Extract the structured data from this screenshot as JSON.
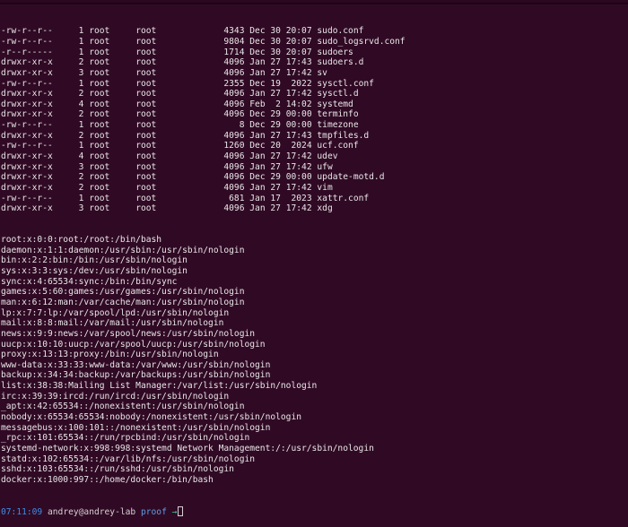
{
  "listing": [
    {
      "perms": "-rw-r--r--",
      "links": "1",
      "owner": "root",
      "group": "root",
      "size": "4343",
      "month": "Dec",
      "day": "30",
      "time": "20:07",
      "name": "sudo.conf"
    },
    {
      "perms": "-rw-r--r--",
      "links": "1",
      "owner": "root",
      "group": "root",
      "size": "9804",
      "month": "Dec",
      "day": "30",
      "time": "20:07",
      "name": "sudo_logsrvd.conf"
    },
    {
      "perms": "-r--r-----",
      "links": "1",
      "owner": "root",
      "group": "root",
      "size": "1714",
      "month": "Dec",
      "day": "30",
      "time": "20:07",
      "name": "sudoers"
    },
    {
      "perms": "drwxr-xr-x",
      "links": "2",
      "owner": "root",
      "group": "root",
      "size": "4096",
      "month": "Jan",
      "day": "27",
      "time": "17:43",
      "name": "sudoers.d"
    },
    {
      "perms": "drwxr-xr-x",
      "links": "3",
      "owner": "root",
      "group": "root",
      "size": "4096",
      "month": "Jan",
      "day": "27",
      "time": "17:42",
      "name": "sv"
    },
    {
      "perms": "-rw-r--r--",
      "links": "1",
      "owner": "root",
      "group": "root",
      "size": "2355",
      "month": "Dec",
      "day": "19",
      "time": " 2022",
      "name": "sysctl.conf"
    },
    {
      "perms": "drwxr-xr-x",
      "links": "2",
      "owner": "root",
      "group": "root",
      "size": "4096",
      "month": "Jan",
      "day": "27",
      "time": "17:42",
      "name": "sysctl.d"
    },
    {
      "perms": "drwxr-xr-x",
      "links": "4",
      "owner": "root",
      "group": "root",
      "size": "4096",
      "month": "Feb",
      "day": " 2",
      "time": "14:02",
      "name": "systemd"
    },
    {
      "perms": "drwxr-xr-x",
      "links": "2",
      "owner": "root",
      "group": "root",
      "size": "4096",
      "month": "Dec",
      "day": "29",
      "time": "00:00",
      "name": "terminfo"
    },
    {
      "perms": "-rw-r--r--",
      "links": "1",
      "owner": "root",
      "group": "root",
      "size": "8",
      "month": "Dec",
      "day": "29",
      "time": "00:00",
      "name": "timezone"
    },
    {
      "perms": "drwxr-xr-x",
      "links": "2",
      "owner": "root",
      "group": "root",
      "size": "4096",
      "month": "Jan",
      "day": "27",
      "time": "17:43",
      "name": "tmpfiles.d"
    },
    {
      "perms": "-rw-r--r--",
      "links": "1",
      "owner": "root",
      "group": "root",
      "size": "1260",
      "month": "Dec",
      "day": "20",
      "time": " 2024",
      "name": "ucf.conf"
    },
    {
      "perms": "drwxr-xr-x",
      "links": "4",
      "owner": "root",
      "group": "root",
      "size": "4096",
      "month": "Jan",
      "day": "27",
      "time": "17:42",
      "name": "udev"
    },
    {
      "perms": "drwxr-xr-x",
      "links": "3",
      "owner": "root",
      "group": "root",
      "size": "4096",
      "month": "Jan",
      "day": "27",
      "time": "17:42",
      "name": "ufw"
    },
    {
      "perms": "drwxr-xr-x",
      "links": "2",
      "owner": "root",
      "group": "root",
      "size": "4096",
      "month": "Dec",
      "day": "29",
      "time": "00:00",
      "name": "update-motd.d"
    },
    {
      "perms": "drwxr-xr-x",
      "links": "2",
      "owner": "root",
      "group": "root",
      "size": "4096",
      "month": "Jan",
      "day": "27",
      "time": "17:42",
      "name": "vim"
    },
    {
      "perms": "-rw-r--r--",
      "links": "1",
      "owner": "root",
      "group": "root",
      "size": "681",
      "month": "Jan",
      "day": "17",
      "time": " 2023",
      "name": "xattr.conf"
    },
    {
      "perms": "drwxr-xr-x",
      "links": "3",
      "owner": "root",
      "group": "root",
      "size": "4096",
      "month": "Jan",
      "day": "27",
      "time": "17:42",
      "name": "xdg"
    }
  ],
  "passwd_lines": [
    "root:x:0:0:root:/root:/bin/bash",
    "daemon:x:1:1:daemon:/usr/sbin:/usr/sbin/nologin",
    "bin:x:2:2:bin:/bin:/usr/sbin/nologin",
    "sys:x:3:3:sys:/dev:/usr/sbin/nologin",
    "sync:x:4:65534:sync:/bin:/bin/sync",
    "games:x:5:60:games:/usr/games:/usr/sbin/nologin",
    "man:x:6:12:man:/var/cache/man:/usr/sbin/nologin",
    "lp:x:7:7:lp:/var/spool/lpd:/usr/sbin/nologin",
    "mail:x:8:8:mail:/var/mail:/usr/sbin/nologin",
    "news:x:9:9:news:/var/spool/news:/usr/sbin/nologin",
    "uucp:x:10:10:uucp:/var/spool/uucp:/usr/sbin/nologin",
    "proxy:x:13:13:proxy:/bin:/usr/sbin/nologin",
    "www-data:x:33:33:www-data:/var/www:/usr/sbin/nologin",
    "backup:x:34:34:backup:/var/backups:/usr/sbin/nologin",
    "list:x:38:38:Mailing List Manager:/var/list:/usr/sbin/nologin",
    "irc:x:39:39:ircd:/run/ircd:/usr/sbin/nologin",
    "_apt:x:42:65534::/nonexistent:/usr/sbin/nologin",
    "nobody:x:65534:65534:nobody:/nonexistent:/usr/sbin/nologin",
    "messagebus:x:100:101::/nonexistent:/usr/sbin/nologin",
    "_rpc:x:101:65534::/run/rpcbind:/usr/sbin/nologin",
    "systemd-network:x:998:998:systemd Network Management:/:/usr/sbin/nologin",
    "statd:x:102:65534::/var/lib/nfs:/usr/sbin/nologin",
    "sshd:x:103:65534::/run/sshd:/usr/sbin/nologin",
    "docker:x:1000:997::/home/docker:/bin/bash"
  ],
  "prompt": {
    "time": "07:11:09",
    "user_host": "andrey@andrey-lab",
    "cwd": "proof",
    "arrow": "→"
  },
  "colors": {
    "background": "#300a24",
    "text": "#e9e6e8",
    "prompt_time": "#3b8eea",
    "prompt_cwd": "#5f9ee8",
    "prompt_arrow": "#4ec0a4"
  }
}
